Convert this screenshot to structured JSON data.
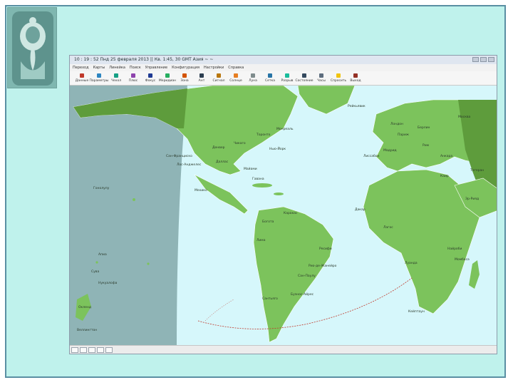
{
  "slide": {
    "background": "#bff2ec",
    "border": "#5a8fa3"
  },
  "window": {
    "title": "10 : 19 : 52  Пнд  25 февраля 2013  ||  Кв. 1:45, 30 GMT  Азия  ~ ~",
    "menu": [
      "Переход",
      "Карты",
      "Линейка",
      "Поиск",
      "Управление",
      "Конфигурация",
      "Настройки",
      "Справка"
    ],
    "toolbar": [
      {
        "label": "Данные",
        "icon": "arrow-icon"
      },
      {
        "label": "Параметры",
        "icon": "clock-icon"
      },
      {
        "label": "Чехол",
        "icon": "compass-icon"
      },
      {
        "label": "Плюс",
        "icon": "plus-icon"
      },
      {
        "label": "Фокус",
        "icon": "square-icon"
      },
      {
        "label": "Меридиан",
        "icon": "globe-icon"
      },
      {
        "label": "Зона",
        "icon": "zone-icon"
      },
      {
        "label": "Ант",
        "icon": "pen-icon"
      },
      {
        "label": "Сигнал",
        "icon": "bell-icon"
      },
      {
        "label": "Солнце",
        "icon": "sun-icon"
      },
      {
        "label": "Луна",
        "icon": "moon-icon"
      },
      {
        "label": "Сетка",
        "icon": "grid-icon"
      },
      {
        "label": "Разрыв",
        "icon": "flag-icon"
      },
      {
        "label": "Состояние",
        "icon": "chart-icon"
      },
      {
        "label": "Часы",
        "icon": "clock2-icon"
      },
      {
        "label": "Спросить",
        "icon": "warning-icon"
      },
      {
        "label": "Выход",
        "icon": "exit-icon"
      }
    ]
  },
  "map": {
    "colors": {
      "night": "#8fb4b6",
      "day": "#d6f7fb",
      "land_day": "#7cc35c",
      "land_night": "#5e9c3c",
      "track": "#c0392b"
    },
    "labels": [
      "Сан-Франциско",
      "Лос-Анджелес",
      "Гонолулу",
      "Сува",
      "Апиа",
      "Нукуалофа",
      "Веллингтон",
      "Окленд",
      "Мехико",
      "Гавана",
      "Богота",
      "Лима",
      "Каракас",
      "Сантьяго",
      "Буэнос-Айрес",
      "Рио-де-Жанейро",
      "Сан-Паулу",
      "Ресифи",
      "Нью-Йорк",
      "Чикаго",
      "Торонто",
      "Монреаль",
      "Даллас",
      "Денвер",
      "Майами",
      "Лондон",
      "Париж",
      "Рим",
      "Берлин",
      "Мадрид",
      "Лиссабон",
      "Каир",
      "Москва",
      "Дакар",
      "Лагос",
      "Найроби",
      "Кейптаун",
      "Луанда",
      "Тегеран",
      "Эр-Рияд",
      "Момбаса",
      "Анкара",
      "Рейкьявик"
    ]
  }
}
